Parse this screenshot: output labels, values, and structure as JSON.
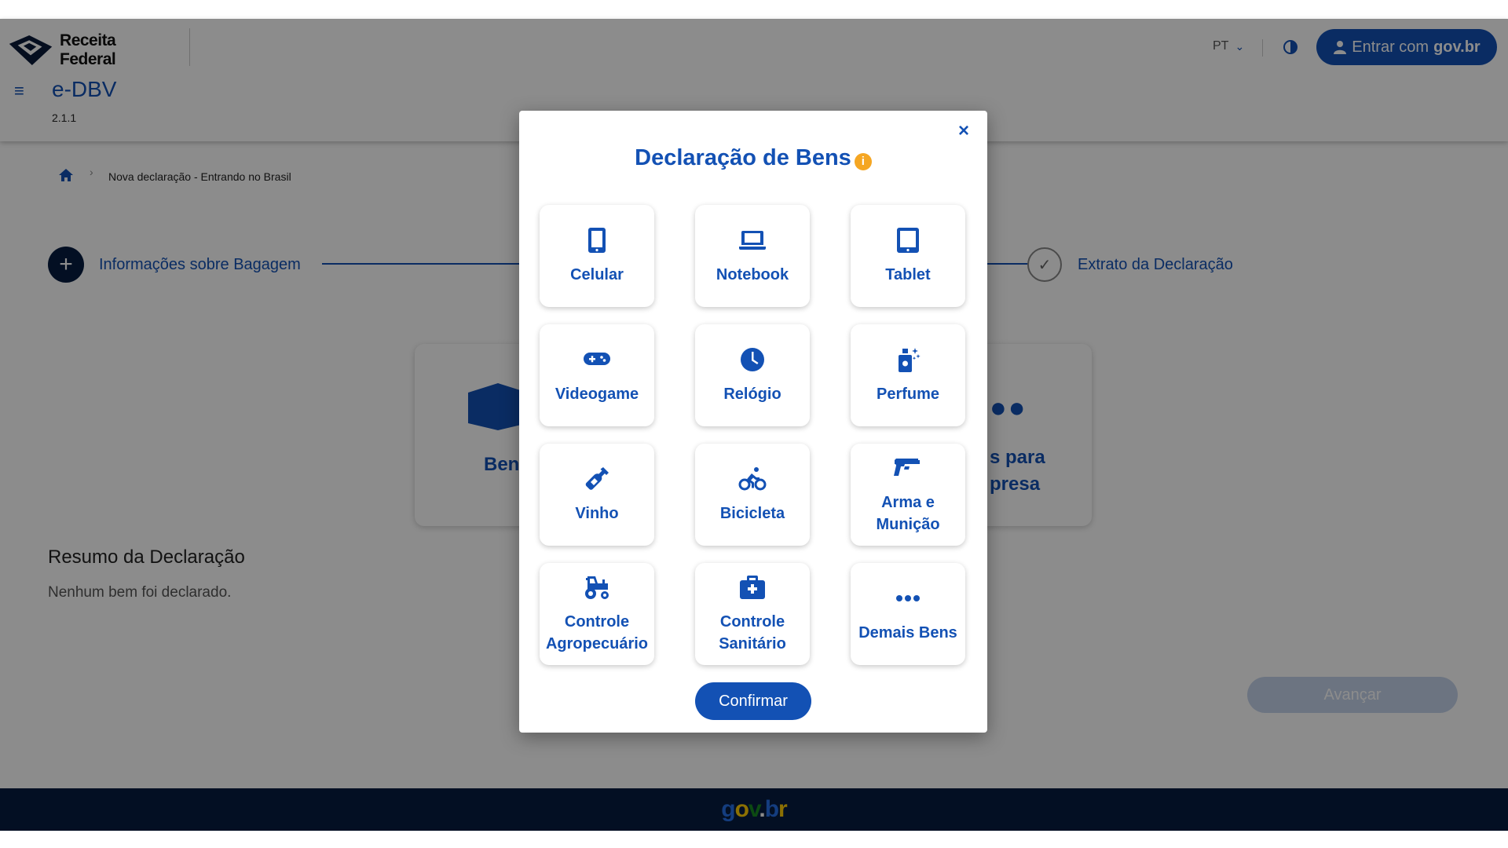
{
  "header": {
    "logo_text": "Receita Federal",
    "app_title": "e-DBV",
    "app_version": "2.1.1",
    "language": "PT",
    "login_prefix": "Entrar com",
    "login_brand": "gov.br"
  },
  "breadcrumb": {
    "current": "Nova declaração - Entrando no Brasil"
  },
  "stepper": {
    "step1_label": "Informações sobre Bagagem",
    "step2_label": "Extrato da Declaração"
  },
  "background_cards": {
    "card1_label": "Ben",
    "card2_line1": "s para",
    "card2_line2": "presa"
  },
  "summary": {
    "title": "Resumo da Declaração",
    "empty_text": "Nenhum bem foi declarado."
  },
  "next_button": "Avançar",
  "footer": {
    "brand": "gov.br"
  },
  "modal": {
    "title": "Declaração de Bens",
    "close": "×",
    "confirm": "Confirmar",
    "items": [
      {
        "label": "Celular",
        "icon": "mobile-icon"
      },
      {
        "label": "Notebook",
        "icon": "laptop-icon"
      },
      {
        "label": "Tablet",
        "icon": "tablet-icon"
      },
      {
        "label": "Videogame",
        "icon": "gamepad-icon"
      },
      {
        "label": "Relógio",
        "icon": "clock-icon"
      },
      {
        "label": "Perfume",
        "icon": "perfume-icon"
      },
      {
        "label": "Vinho",
        "icon": "wine-bottle-icon"
      },
      {
        "label": "Bicicleta",
        "icon": "bicycle-icon"
      },
      {
        "label": "Arma e Munição",
        "icon": "gun-icon"
      },
      {
        "label": "Controle Agropecuário",
        "icon": "tractor-icon"
      },
      {
        "label": "Controle Sanitário",
        "icon": "medical-kit-icon"
      },
      {
        "label": "Demais Bens",
        "icon": "ellipsis-icon"
      }
    ]
  },
  "colors": {
    "primary": "#1351b4",
    "dark": "#071d41",
    "info": "#f5a623"
  }
}
